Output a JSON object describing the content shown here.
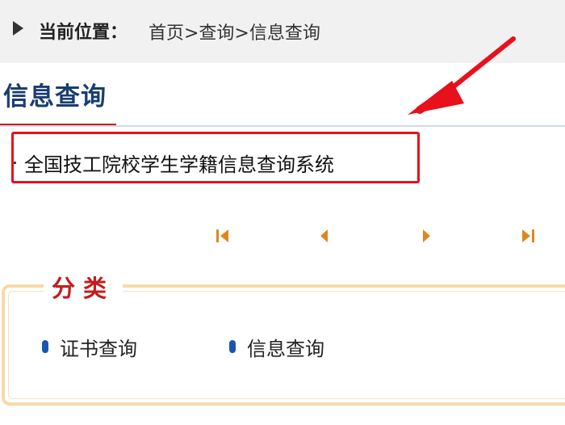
{
  "breadcrumb": {
    "label": "当前位置：",
    "path": "首页>查询>信息查询"
  },
  "section": {
    "title": "信息查询"
  },
  "system_link": {
    "text": "全国技工院校学生学籍信息查询系统"
  },
  "pager": {
    "first_icon": "first-page-icon",
    "prev_icon": "previous-page-icon",
    "next_icon": "next-page-icon",
    "last_icon": "last-page-icon"
  },
  "category": {
    "legend": "分类",
    "items": [
      {
        "label": "证书查询"
      },
      {
        "label": "信息查询"
      }
    ]
  },
  "colors": {
    "accent_red": "#c81f1f",
    "title_blue": "#1a3d72",
    "highlight_box": "#e8101a",
    "pager_orange": "#d98a1f",
    "bullet_blue": "#1c55b0",
    "fieldset_border": "#f6dba6"
  }
}
